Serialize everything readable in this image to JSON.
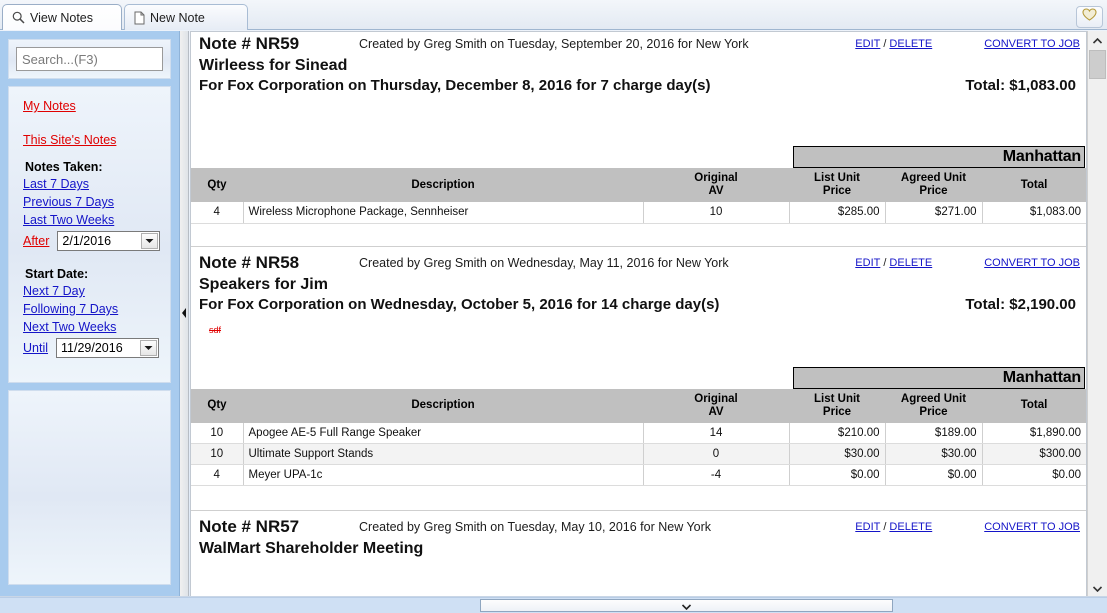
{
  "window": {
    "favorite_icon": "heart-icon"
  },
  "tabs": [
    {
      "id": "view-notes",
      "label": "View Notes",
      "icon": "magnifier-icon",
      "active": true
    },
    {
      "id": "new-note",
      "label": "New Note",
      "icon": "page-icon",
      "active": false
    }
  ],
  "sidebar": {
    "search": {
      "placeholder": "Search...(F3)",
      "value": "",
      "icon": "search-icon"
    },
    "links_top": [
      {
        "label": "My Notes",
        "color": "red"
      },
      {
        "label": "This Site's Notes",
        "color": "red"
      }
    ],
    "notes_taken": {
      "heading": "Notes Taken:",
      "links": [
        {
          "label": "Last 7 Days",
          "color": "blue"
        },
        {
          "label": "Previous 7 Days",
          "color": "blue"
        },
        {
          "label": "Last  Two  Weeks",
          "color": "blue"
        }
      ],
      "after_label": "After",
      "after_value": "2/1/2016"
    },
    "start_date": {
      "heading": "Start Date:",
      "links": [
        {
          "label": "Next 7 Day",
          "color": "blue"
        },
        {
          "label": "Following 7 Days",
          "color": "blue"
        },
        {
          "label": "Next Two  Weeks",
          "color": "blue"
        }
      ],
      "until_label": "Until",
      "until_value": "11/29/2016"
    }
  },
  "actions": {
    "edit": "EDIT",
    "separator": "/",
    "delete": "DELETE",
    "convert": "CONVERT TO JOB"
  },
  "table_headers": {
    "qty": "Qty",
    "description": "Description",
    "original_av_line1": "Original",
    "original_av_line2": "AV",
    "list_unit_line1": "List Unit",
    "list_unit_line2": "Price",
    "agreed_unit_line1": "Agreed Unit",
    "agreed_unit_line2": "Price",
    "total": "Total"
  },
  "notes": [
    {
      "number": "Note # NR59",
      "created": "Created by Greg Smith on Tuesday, September 20, 2016 for New York",
      "title": "Wirleess for Sinead",
      "subtitle": "For Fox Corporation on Thursday, December 8, 2016 for 7 charge day(s)",
      "total": "Total: $1,083.00",
      "memo": "",
      "site": "Manhattan",
      "rows": [
        {
          "qty": "4",
          "description": "Wireless Microphone Package, Sennheiser",
          "av": "10",
          "list": "$285.00",
          "agreed": "$271.00",
          "total": "$1,083.00"
        }
      ]
    },
    {
      "number": "Note # NR58",
      "created": "Created by Greg Smith on Wednesday, May 11, 2016 for New York",
      "title": "Speakers for Jim",
      "subtitle": "For Fox Corporation on Wednesday, October 5, 2016 for 14 charge day(s)",
      "total": "Total: $2,190.00",
      "memo": "sdf",
      "site": "Manhattan",
      "rows": [
        {
          "qty": "10",
          "description": "Apogee AE-5 Full Range Speaker",
          "av": "14",
          "list": "$210.00",
          "agreed": "$189.00",
          "total": "$1,890.00"
        },
        {
          "qty": "10",
          "description": "Ultimate Support Stands",
          "av": "0",
          "list": "$30.00",
          "agreed": "$30.00",
          "total": "$300.00"
        },
        {
          "qty": "4",
          "description": "Meyer UPA-1c",
          "av": "-4",
          "list": "$0.00",
          "agreed": "$0.00",
          "total": "$0.00"
        }
      ]
    },
    {
      "number": "Note # NR57",
      "created": "Created by Greg Smith on Tuesday, May 10, 2016 for New York",
      "title": "WalMart Shareholder Meeting",
      "subtitle": "",
      "total": "",
      "memo": "",
      "site": "",
      "rows": []
    }
  ],
  "colors": {
    "accent_link_red": "#e00000",
    "accent_link_blue": "#1414c8",
    "sidebar_bg": "#a8cbee",
    "table_header_bg": "#c0c0c0",
    "banner_bg": "#c0c0c0"
  }
}
